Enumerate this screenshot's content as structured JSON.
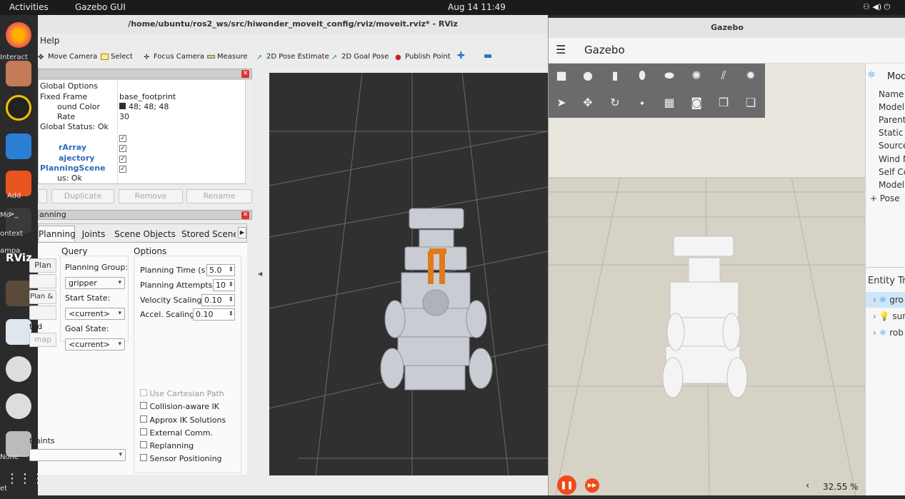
{
  "topbar": {
    "activities": "Activities",
    "app": "Gazebo GUI",
    "clock": "Aug 14  11:49"
  },
  "dock": {
    "labels": [
      "Interact",
      "Add",
      "Mo",
      "ontext",
      "ampa",
      "Plan",
      "Plan",
      "ted",
      "None",
      "et"
    ]
  },
  "rviz": {
    "title": "/home/ubuntu/ros2_ws/src/hiwonder_moveit_config/rviz/moveit.rviz* - RViz",
    "menu": {
      "help": "Help"
    },
    "toolbar": {
      "move_camera": "Move Camera",
      "select": "Select",
      "focus_camera": "Focus Camera",
      "measure": "Measure",
      "pose_estimate": "2D Pose Estimate",
      "goal_pose": "2D Goal Pose",
      "publish_point": "Publish Point"
    },
    "displays": {
      "global_options": "Global Options",
      "fixed_frame": "Fixed Frame",
      "fixed_frame_value": "base_footprint",
      "bg_color": "ound Color",
      "bg_color_value": "48; 48; 48",
      "frame_rate": "Rate",
      "frame_rate_value": "30",
      "global_status": "Global Status: Ok",
      "marker_array": "rArray",
      "trajectory": "ajectory",
      "planning_scene": "PlanningScene",
      "status": "us: Ok",
      "check": "✓"
    },
    "display_buttons": {
      "duplicate": "Duplicate",
      "remove": "Remove",
      "rename": "Rename"
    },
    "motion_panel": {
      "title": "anning"
    },
    "tabs": [
      "Planning",
      "Joints",
      "Scene Objects",
      "Stored Scene"
    ],
    "query": {
      "header": "Query",
      "planning_group_label": "Planning Group:",
      "planning_group": "gripper",
      "start_state_label": "Start State:",
      "start_state": "<current>",
      "goal_state_label": "Goal State:",
      "goal_state": "<current>"
    },
    "left_buttons": {
      "plan": "Plan",
      "plan_execute": "Plan & Execute",
      "executed": "ted",
      "map": "map",
      "constraints": "traints"
    },
    "options": {
      "header": "Options",
      "planning_time_label": "Planning Time (s):",
      "planning_time": "5.0",
      "planning_attempts_label": "Planning Attempts:",
      "planning_attempts": "10",
      "velocity_label": "Velocity Scaling:",
      "velocity": "0.10",
      "accel_label": "Accel. Scaling:",
      "accel": "0.10",
      "use_cartesian": "Use Cartesian Path",
      "collision_ik": "Collision-aware IK",
      "approx_ik": "Approx IK Solutions",
      "external_comm": "External Comm.",
      "replanning": "Replanning",
      "sensor_pos": "Sensor Positioning"
    }
  },
  "gazebo": {
    "title": "Gazebo",
    "header": "Gazebo",
    "side": {
      "component": "Mod",
      "props": [
        "Name",
        "Model",
        "Parent",
        "Static",
        "Source",
        "Wind M",
        "Self Co",
        "Model"
      ],
      "pose": "+ Pose",
      "entity_tree": "Entity Tre",
      "entities": [
        "gro",
        "sun",
        "rob"
      ]
    },
    "zoom": "32.55 %",
    "zoom_arrow": "‹"
  }
}
